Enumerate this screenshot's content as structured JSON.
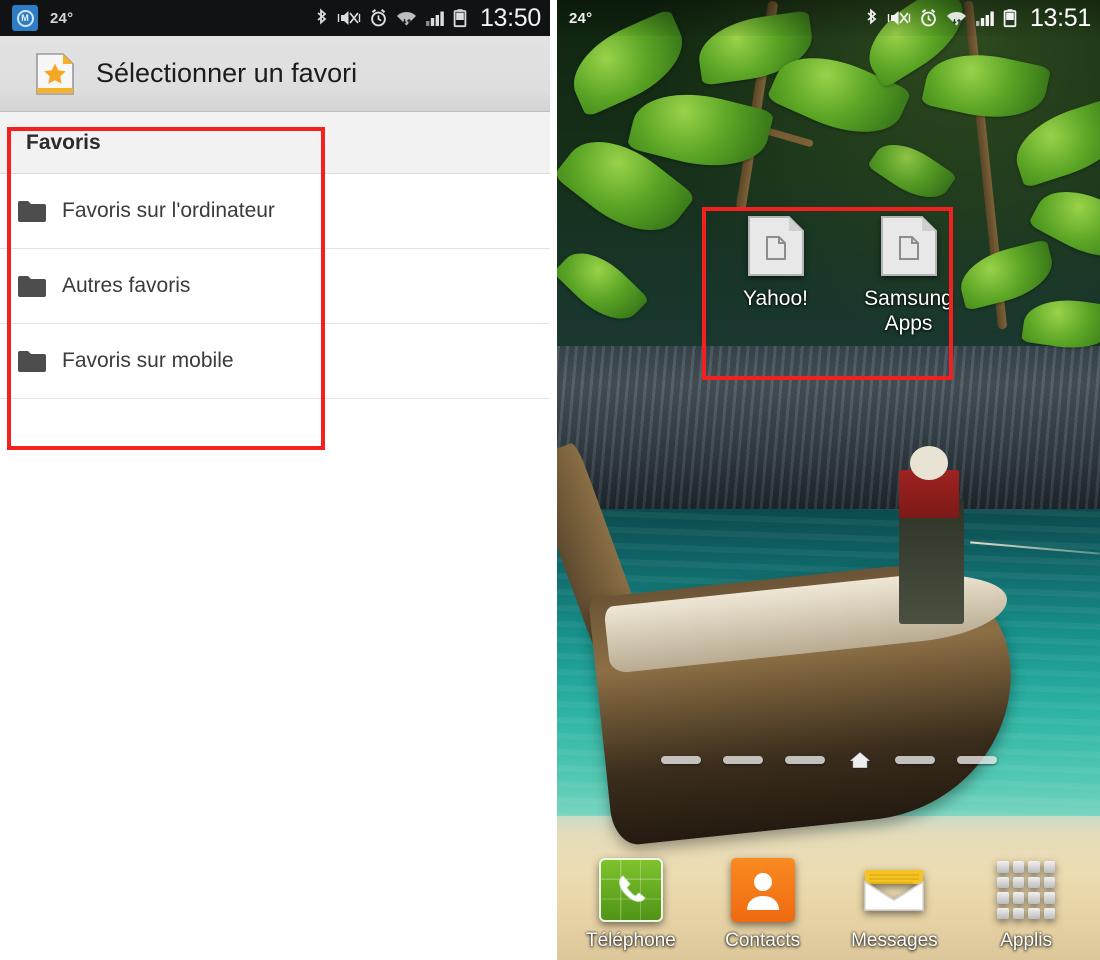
{
  "left_panel": {
    "statusbar": {
      "weather_glyph": "M",
      "temperature": "24°",
      "clock": "13:50",
      "icons": [
        "bluetooth-icon",
        "vibrate-mute-icon",
        "alarm-icon",
        "wifi-icon",
        "signal-icon",
        "battery-icon"
      ]
    },
    "titlebar": {
      "icon": "bookmark-star-icon",
      "title": "Sélectionner un favori"
    },
    "list": {
      "header": "Favoris",
      "rows": [
        {
          "icon": "folder-icon",
          "label": "Favoris sur l'ordinateur"
        },
        {
          "icon": "folder-icon",
          "label": "Autres favoris"
        },
        {
          "icon": "folder-icon",
          "label": "Favoris sur mobile"
        }
      ]
    },
    "highlight_color": "#f41f1f"
  },
  "right_panel": {
    "statusbar": {
      "temperature": "24°",
      "clock": "13:51",
      "icons": [
        "bluetooth-icon",
        "vibrate-mute-icon",
        "alarm-icon",
        "wifi-icon",
        "signal-icon",
        "battery-icon"
      ]
    },
    "shortcuts": [
      {
        "icon": "bookmark-page-icon",
        "label": "Yahoo!"
      },
      {
        "icon": "bookmark-page-icon",
        "label": "Samsung Apps"
      }
    ],
    "page_indicator": {
      "count": 6,
      "current_index": 3,
      "current_icon": "home-icon"
    },
    "dock": [
      {
        "icon": "phone-icon",
        "label": "Téléphone"
      },
      {
        "icon": "contacts-icon",
        "label": "Contacts"
      },
      {
        "icon": "messages-icon",
        "label": "Messages"
      },
      {
        "icon": "apps-grid-icon",
        "label": "Applis"
      }
    ],
    "highlight_color": "#f41f1f"
  }
}
